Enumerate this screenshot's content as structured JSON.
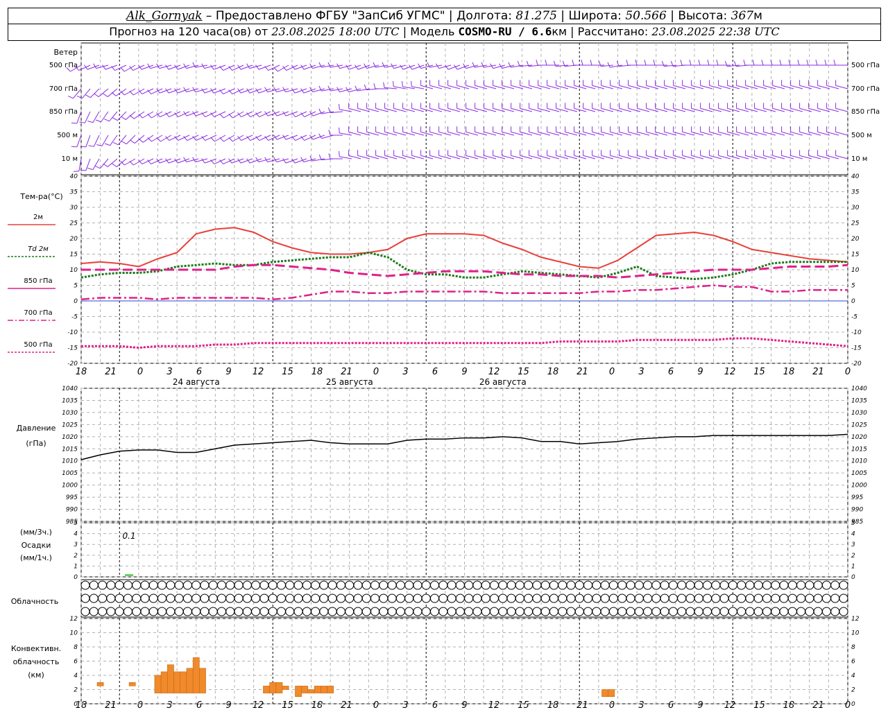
{
  "header": {
    "station": "Alk_Gornyak",
    "dash": " – ",
    "provider": "Предоставлено ФГБУ \"ЗапСиб УГМС\"",
    "lon_label": "Долгота:",
    "lon": "81.275",
    "lat_label": "Широта:",
    "lat": "50.566",
    "alt_label": "Высота:",
    "alt": "367",
    "alt_unit": "м",
    "forecast_label": "Прогноз на 120 часа(ов) от",
    "forecast_from": "23.08.2025 18:00 UTC",
    "model_label": "Модель",
    "model": "COSMO-RU / 6.6",
    "model_unit": "км",
    "computed_label": "Рассчитано:",
    "computed": "23.08.2025 22:38 UTC",
    "sep": "|"
  },
  "colors": {
    "t2m": "#e8403a",
    "td": "#1a7a1a",
    "t850": "#e0208a",
    "t700": "#e0208a",
    "t500": "#e0208a",
    "wind": "#8a2be2",
    "conv": "#f08a2a",
    "precip": "#22bb22",
    "grid": "#b0b0b0"
  },
  "wind_panel": {
    "title": "Ветер",
    "levels": [
      "500 гПа",
      "700 гПа",
      "850 гПа",
      "500 м",
      "10 м"
    ],
    "dir_deg": [
      [
        240,
        245,
        250,
        255,
        250,
        245,
        240,
        245,
        250,
        255,
        255,
        250,
        250,
        255,
        260,
        255,
        250,
        245,
        245,
        250,
        255,
        250,
        245,
        240,
        245,
        250,
        250,
        255,
        260,
        260,
        255,
        250,
        250,
        255,
        260,
        260,
        255,
        250,
        250,
        255,
        260,
        255,
        250,
        250,
        255,
        260,
        260,
        255,
        255,
        260,
        265,
        265,
        270,
        270,
        265,
        265,
        270,
        270,
        270,
        265,
        260,
        265,
        270,
        270,
        270,
        270,
        265,
        265,
        270,
        270,
        270,
        270,
        270,
        265,
        265,
        270,
        270,
        270,
        270,
        270,
        270,
        270,
        270,
        270,
        270,
        270
      ],
      [
        220,
        220,
        225,
        230,
        230,
        235,
        240,
        240,
        245,
        245,
        250,
        250,
        250,
        255,
        255,
        250,
        250,
        245,
        245,
        250,
        250,
        250,
        255,
        255,
        255,
        250,
        250,
        255,
        260,
        260,
        255,
        255,
        260,
        265,
        270,
        275,
        280,
        280,
        280,
        285,
        285,
        285,
        285,
        285,
        285,
        285,
        285,
        285,
        285,
        285,
        285,
        285,
        285,
        285,
        285,
        285,
        285,
        285,
        285,
        285,
        285,
        285,
        285,
        285,
        285,
        285,
        285,
        285,
        285,
        285,
        285,
        285,
        285,
        285,
        285,
        285,
        285,
        285,
        285,
        285,
        285,
        285,
        285,
        285,
        285,
        285
      ],
      [
        200,
        205,
        210,
        215,
        220,
        225,
        230,
        235,
        240,
        240,
        245,
        245,
        245,
        250,
        250,
        245,
        245,
        240,
        240,
        245,
        245,
        245,
        250,
        250,
        250,
        245,
        245,
        250,
        260,
        265,
        280,
        285,
        285,
        285,
        285,
        285,
        285,
        285,
        285,
        285,
        285,
        285,
        285,
        285,
        285,
        285,
        285,
        285,
        285,
        285,
        285,
        285,
        285,
        285,
        285,
        285,
        285,
        285,
        285,
        285,
        285,
        285,
        285,
        285,
        285,
        285,
        285,
        285,
        285,
        285,
        285,
        285,
        285,
        285,
        285,
        285,
        285,
        285,
        285,
        285,
        285,
        285,
        285,
        285,
        285,
        285
      ],
      [
        200,
        200,
        205,
        210,
        215,
        220,
        225,
        230,
        235,
        240,
        240,
        245,
        245,
        245,
        245,
        245,
        240,
        240,
        240,
        245,
        245,
        245,
        245,
        250,
        250,
        245,
        245,
        250,
        255,
        270,
        280,
        285,
        285,
        285,
        285,
        285,
        285,
        285,
        285,
        285,
        285,
        285,
        285,
        285,
        285,
        285,
        285,
        285,
        285,
        285,
        285,
        285,
        285,
        285,
        285,
        285,
        285,
        285,
        285,
        285,
        285,
        285,
        285,
        285,
        285,
        285,
        285,
        285,
        285,
        285,
        285,
        285,
        285,
        285,
        285,
        285,
        285,
        285,
        285,
        285,
        285,
        285,
        285,
        285,
        285,
        285
      ],
      [
        190,
        200,
        210,
        220,
        230,
        230,
        240,
        240,
        245,
        245,
        250,
        250,
        250,
        255,
        255,
        250,
        245,
        245,
        250,
        250,
        250,
        255,
        255,
        255,
        250,
        250,
        255,
        260,
        265,
        270,
        280,
        285,
        285,
        285,
        285,
        285,
        285,
        285,
        285,
        285,
        285,
        285,
        285,
        285,
        285,
        285,
        285,
        285,
        285,
        285,
        285,
        285,
        285,
        285,
        285,
        285,
        285,
        285,
        285,
        285,
        285,
        285,
        285,
        285,
        285,
        285,
        285,
        285,
        285,
        285,
        285,
        285,
        285,
        285,
        285,
        285,
        285,
        285,
        285,
        285,
        285,
        285,
        285,
        285,
        285,
        285
      ]
    ]
  },
  "temp_panel": {
    "title": "Тем-ра(°C)",
    "legend": [
      {
        "label": "2м",
        "style": "solid",
        "key": "t2m"
      },
      {
        "label": "Td  2м",
        "style": "dotted",
        "key": "td"
      },
      {
        "label": "850 гПа",
        "style": "solid",
        "key": "t850"
      },
      {
        "label": "700 гПа",
        "style": "dashdot",
        "key": "t700"
      },
      {
        "label": "500 гПа",
        "style": "dotted",
        "key": "t500"
      }
    ],
    "y_ticks": [
      40,
      35,
      30,
      25,
      20,
      15,
      10,
      5,
      0,
      -5,
      -10,
      -15,
      -20
    ]
  },
  "time_axis": {
    "tick_labels": [
      "18",
      "21",
      "0",
      "3",
      "6",
      "9",
      "12",
      "15",
      "18",
      "21",
      "0",
      "3",
      "6",
      "9",
      "12",
      "15",
      "18",
      "21",
      "0",
      "3",
      "6",
      "9",
      "12",
      "15",
      "18",
      "21",
      "0"
    ],
    "days": [
      "24 августа",
      "25 августа",
      "26 августа"
    ]
  },
  "pressure_panel": {
    "title": "Давление",
    "unit": "(гПа)",
    "y_ticks": [
      1040,
      1035,
      1030,
      1025,
      1020,
      1015,
      1010,
      1005,
      1000,
      995,
      990,
      985
    ]
  },
  "precip_panel": {
    "label1": "(мм/3ч.)",
    "label2": "Осадки",
    "label3": "(мм/1ч.)",
    "y_ticks": [
      5,
      4,
      3,
      2,
      1,
      0
    ],
    "annotation": "0.1",
    "annotation_hour": 7.5
  },
  "cloud_panel": {
    "title": "Облачность",
    "rows": [
      "OOOOOOOOOOOOOOOOOOOOOOOOOOOOOOOOOOOOOOOOOOOOOOOOOOOOOOOOOOOOOOOOOOOOOOOOOOOOOOOOOOOOOOOOOO",
      "OOOOOOOOOOOOOOOOOOOOOOOOOOOOOOOOOOOOOOOOOOOOOOOOOOOOOOOOOOOOOOOOOOOOOOOOOOOOOOOOOOOOOOOOOO",
      "OOOOOOOOOOOOOOOOOOOOOOOOOOOOOOOOOOOOOOOOOOOOOOOOOOOOOOOOOOOOOOOOOOOOOOOOOOOOOOOOOOOOOOOOOO"
    ]
  },
  "conv_panel": {
    "label1": "Конвективн.",
    "label2": "облачность",
    "label3": "(км)",
    "y_ticks": [
      12,
      10,
      8,
      6,
      4,
      2,
      0
    ]
  },
  "chart_data": {
    "type": "line",
    "x_hours_from_start": [
      0,
      3,
      6,
      9,
      12,
      15,
      18,
      21,
      24,
      27,
      30,
      33,
      36,
      39,
      42,
      45,
      48,
      51,
      54,
      57,
      60,
      63,
      66,
      69,
      72,
      75,
      78,
      81,
      84,
      87,
      90,
      93,
      96,
      99,
      102,
      105,
      108,
      111,
      114,
      117,
      120
    ],
    "series": [
      {
        "name": "2м",
        "values": [
          12,
          12.5,
          12,
          11,
          13.5,
          15.5,
          21.5,
          23,
          23.5,
          22,
          19,
          17,
          15.5,
          15,
          15,
          15.5,
          16.5,
          20,
          21.5,
          21.5,
          21.5,
          21,
          18.5,
          16.5,
          14,
          12.5,
          11,
          10.5,
          13,
          17,
          21,
          21.5,
          22,
          21,
          19,
          16.5,
          15.5,
          14.5,
          13.5,
          13,
          12.5
        ]
      },
      {
        "name": "Td  2м",
        "values": [
          7.5,
          8.5,
          9,
          9,
          9.5,
          11,
          11.5,
          12,
          11.5,
          11.5,
          12.5,
          13,
          13.5,
          14,
          14,
          15.5,
          14,
          10,
          8.5,
          8.5,
          7.5,
          7.5,
          8.5,
          9.5,
          9,
          8.5,
          8,
          7.5,
          9,
          11,
          8,
          7.5,
          7,
          7.5,
          8.5,
          10,
          12,
          12.5,
          12.5,
          12.5,
          12.5
        ]
      },
      {
        "name": "850 гПа",
        "values": [
          10,
          10,
          10,
          10,
          10,
          10,
          10,
          10,
          11,
          11.5,
          11.5,
          11,
          10.5,
          10,
          9,
          8.5,
          8,
          8.5,
          9,
          9.5,
          9.5,
          9.5,
          9,
          8.5,
          8.5,
          8,
          8,
          8,
          7.5,
          8,
          8.5,
          9,
          9.5,
          10,
          10,
          10,
          10.5,
          11,
          11,
          11,
          11.5
        ]
      },
      {
        "name": "700 гПа",
        "values": [
          0.5,
          1,
          1,
          1,
          0.5,
          1,
          1,
          1,
          1,
          1,
          0.5,
          1,
          2,
          3,
          3,
          2.5,
          2.5,
          3,
          3,
          3,
          3,
          3,
          2.5,
          2.5,
          2.5,
          2.5,
          2.5,
          3,
          3,
          3.5,
          3.5,
          4,
          4.5,
          5,
          4.5,
          4.5,
          3,
          3,
          3.5,
          3.5,
          3.5
        ]
      },
      {
        "name": "500 гПа",
        "values": [
          -14.5,
          -14.5,
          -14.5,
          -15,
          -14.5,
          -14.5,
          -14.5,
          -14,
          -14,
          -13.5,
          -13.5,
          -13.5,
          -13.5,
          -13.5,
          -13.5,
          -13.5,
          -13.5,
          -13.5,
          -13.5,
          -13.5,
          -13.5,
          -13.5,
          -13.5,
          -13.5,
          -13.5,
          -13,
          -13,
          -13,
          -13,
          -12.5,
          -12.5,
          -12.5,
          -12.5,
          -12.5,
          -12,
          -12,
          -12.5,
          -13,
          -13.5,
          -14,
          -14.5
        ]
      },
      {
        "name": "Давление",
        "values": [
          1010.5,
          1012.5,
          1014,
          1014.5,
          1014.5,
          1013.5,
          1013.5,
          1015,
          1016.5,
          1017,
          1017.5,
          1018,
          1018.5,
          1017.5,
          1017,
          1017,
          1017,
          1018.5,
          1019,
          1019,
          1019.5,
          1019.5,
          1020,
          1019.5,
          1018,
          1018,
          1017,
          1017.5,
          1018,
          1019,
          1019.5,
          1020,
          1020,
          1020.5,
          1020.5,
          1020.5,
          1020.5,
          1020.5,
          1020.5,
          1020.5,
          1021
        ]
      }
    ],
    "precip_mm": [
      {
        "hour": 7.5,
        "value": 0.1
      }
    ],
    "convective_km": [
      {
        "hour": 3,
        "top": 3,
        "base": 2.5
      },
      {
        "hour": 8,
        "top": 3,
        "base": 2.5
      },
      {
        "hour": 12,
        "top": 4,
        "base": 1.5
      },
      {
        "hour": 13,
        "top": 4.5,
        "base": 1.5
      },
      {
        "hour": 14,
        "top": 5.5,
        "base": 1.5
      },
      {
        "hour": 15,
        "top": 4.5,
        "base": 1.5
      },
      {
        "hour": 16,
        "top": 4.5,
        "base": 1.5
      },
      {
        "hour": 17,
        "top": 5,
        "base": 1.5
      },
      {
        "hour": 18,
        "top": 6.5,
        "base": 1.5
      },
      {
        "hour": 19,
        "top": 5,
        "base": 1.5
      },
      {
        "hour": 29,
        "top": 2.5,
        "base": 1.5
      },
      {
        "hour": 30,
        "top": 3,
        "base": 1.5
      },
      {
        "hour": 31,
        "top": 3,
        "base": 1.5
      },
      {
        "hour": 32,
        "top": 2.5,
        "base": 2
      },
      {
        "hour": 34,
        "top": 2.5,
        "base": 1
      },
      {
        "hour": 35,
        "top": 2.5,
        "base": 1.5
      },
      {
        "hour": 36,
        "top": 2,
        "base": 1.5
      },
      {
        "hour": 37,
        "top": 2.5,
        "base": 1.5
      },
      {
        "hour": 38,
        "top": 2.5,
        "base": 1.5
      },
      {
        "hour": 39,
        "top": 2.5,
        "base": 1.5
      },
      {
        "hour": 82,
        "top": 2,
        "base": 1
      },
      {
        "hour": 83,
        "top": 2,
        "base": 1
      }
    ],
    "temp_ylim": [
      -20,
      40
    ],
    "pressure_ylim": [
      985,
      1040
    ],
    "precip_ylim": [
      0,
      5
    ],
    "conv_ylim": [
      0,
      12
    ],
    "grid": true
  }
}
